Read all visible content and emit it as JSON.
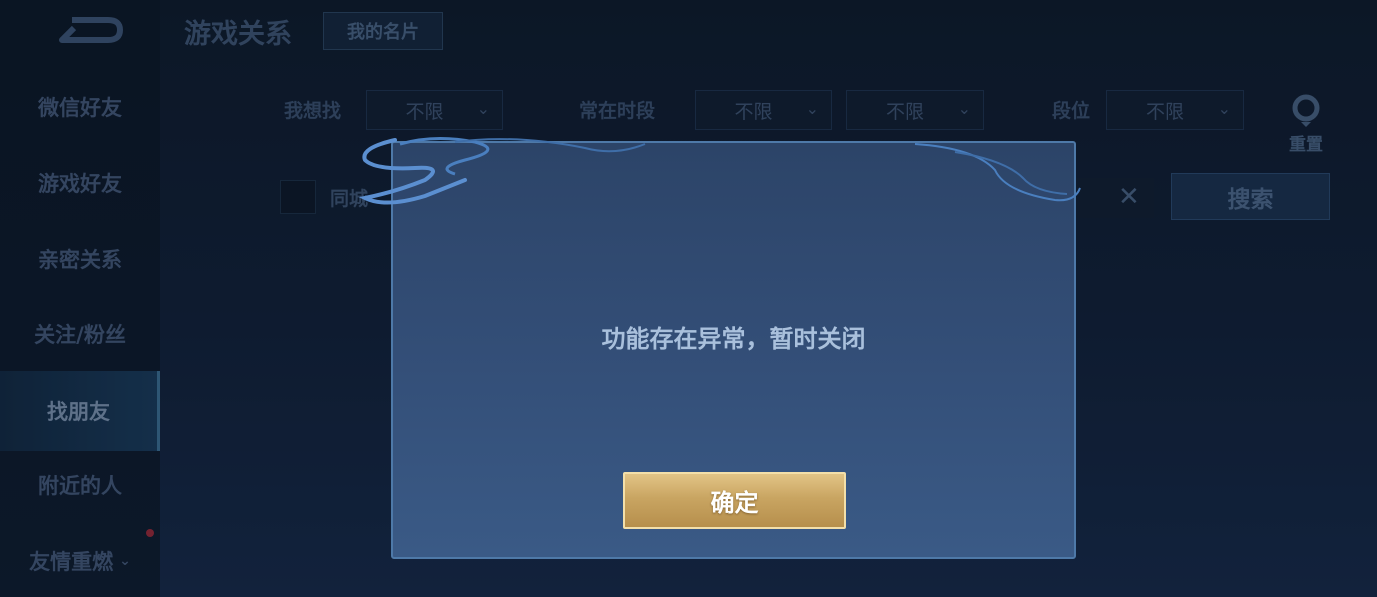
{
  "header": {
    "title": "游戏关系",
    "my_card_label": "我的名片"
  },
  "sidebar": {
    "items": [
      {
        "label": "微信好友"
      },
      {
        "label": "游戏好友"
      },
      {
        "label": "亲密关系"
      },
      {
        "label": "关注/粉丝"
      },
      {
        "label": "找朋友",
        "active": true
      },
      {
        "label": "附近的人"
      },
      {
        "label": "友情重燃"
      }
    ]
  },
  "filters": {
    "want_label": "我想找",
    "want_value": "不限",
    "time_label": "常在时段",
    "time_value_1": "不限",
    "time_value_2": "不限",
    "rank_label": "段位",
    "rank_value": "不限",
    "reset_label": "重置",
    "city_label": "同城",
    "search_label": "搜索"
  },
  "dialog": {
    "message": "功能存在异常，暂时关闭",
    "confirm_label": "确定"
  },
  "colors": {
    "accent_gold": "#c9a562",
    "dialog_bg": "#334e77",
    "background": "#12213a"
  }
}
